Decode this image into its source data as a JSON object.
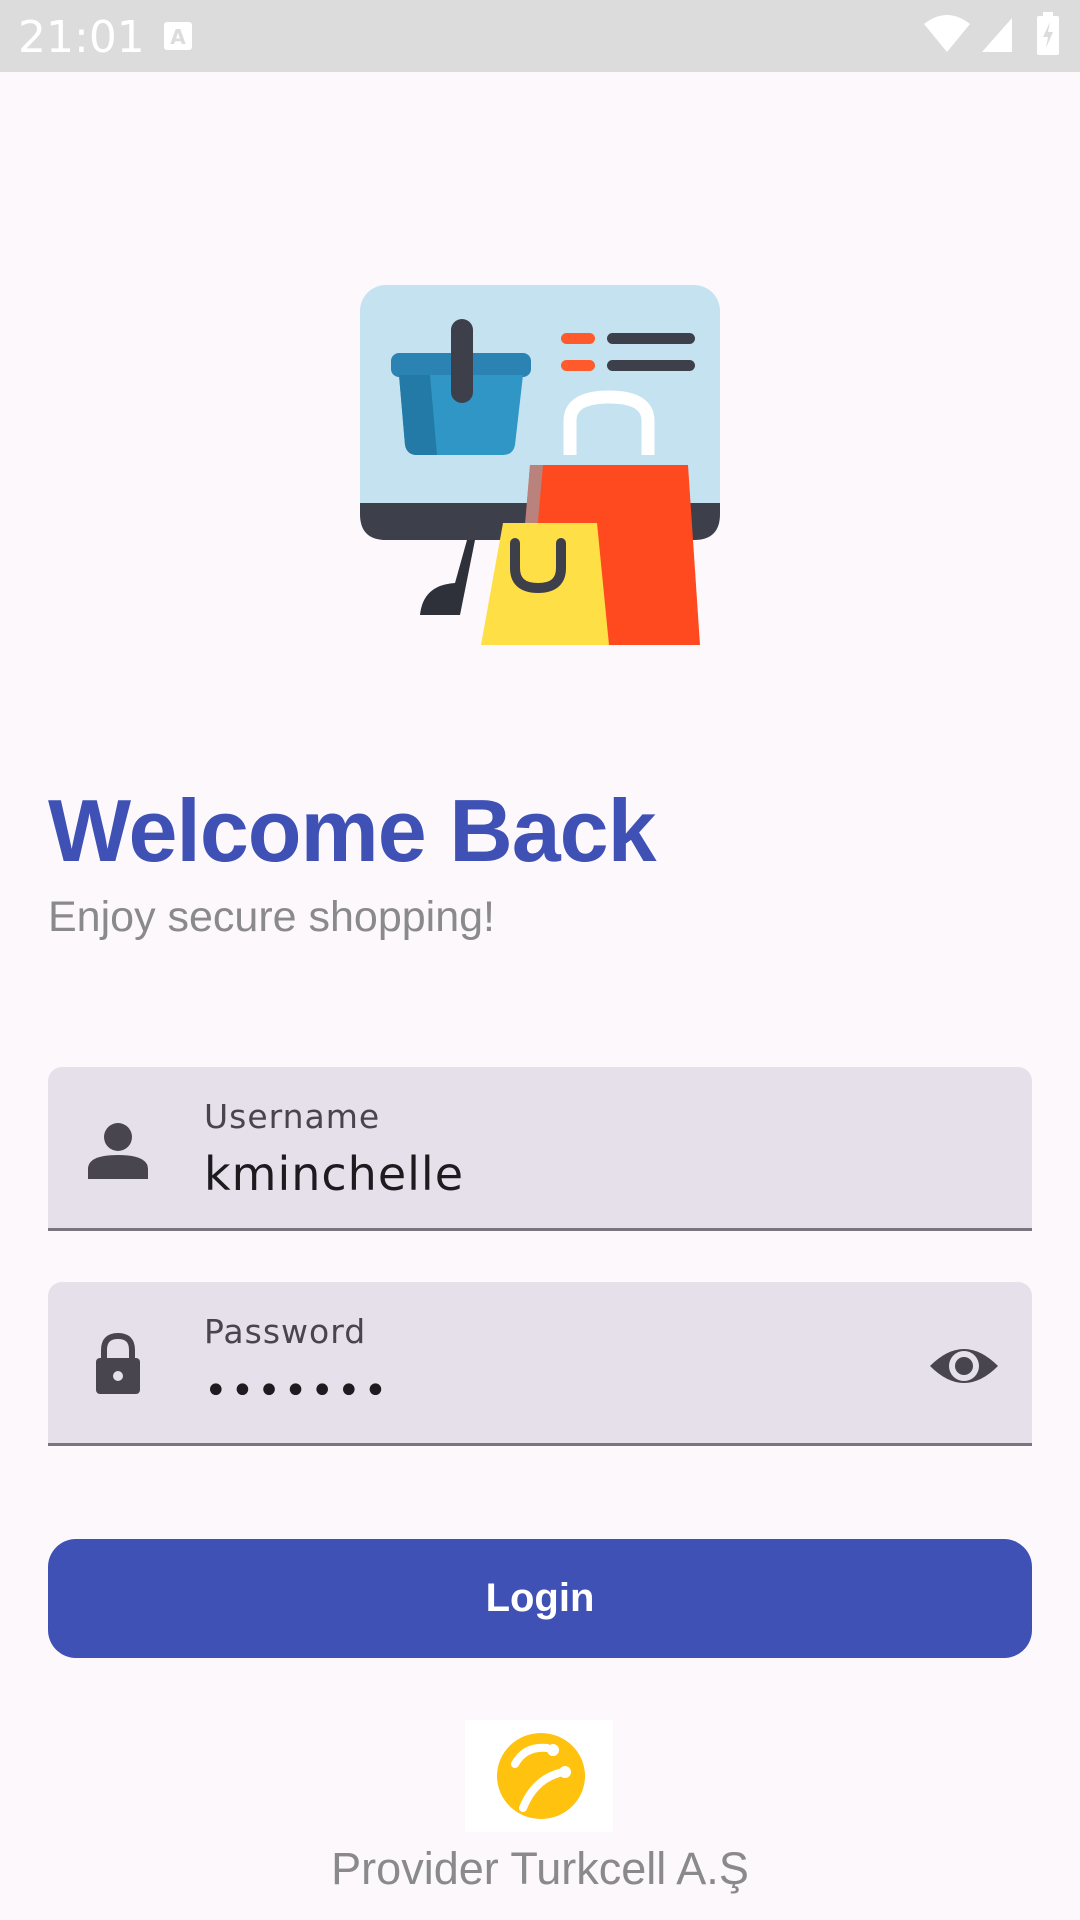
{
  "status_bar": {
    "time": "21:01",
    "icons": [
      "a-notification-icon",
      "wifi-icon",
      "signal-icon",
      "battery-charging-icon"
    ]
  },
  "hero": {
    "icon": "shopping-illustration-icon"
  },
  "header": {
    "title": "Welcome Back",
    "subtitle": "Enjoy secure shopping!"
  },
  "form": {
    "username": {
      "label": "Username",
      "value": "kminchelle",
      "icon": "person-icon"
    },
    "password": {
      "label": "Password",
      "value": "•••••••",
      "icon": "lock-icon",
      "toggle_icon": "eye-icon"
    },
    "login_label": "Login"
  },
  "footer": {
    "logo_icon": "turkcell-logo-icon",
    "provider_text": "Provider Turkcell A.Ş"
  },
  "colors": {
    "primary": "#3f51b5",
    "background": "#fcf8fc",
    "field_background": "#e6e0eb",
    "subtitle_gray": "#8a8a8a"
  }
}
